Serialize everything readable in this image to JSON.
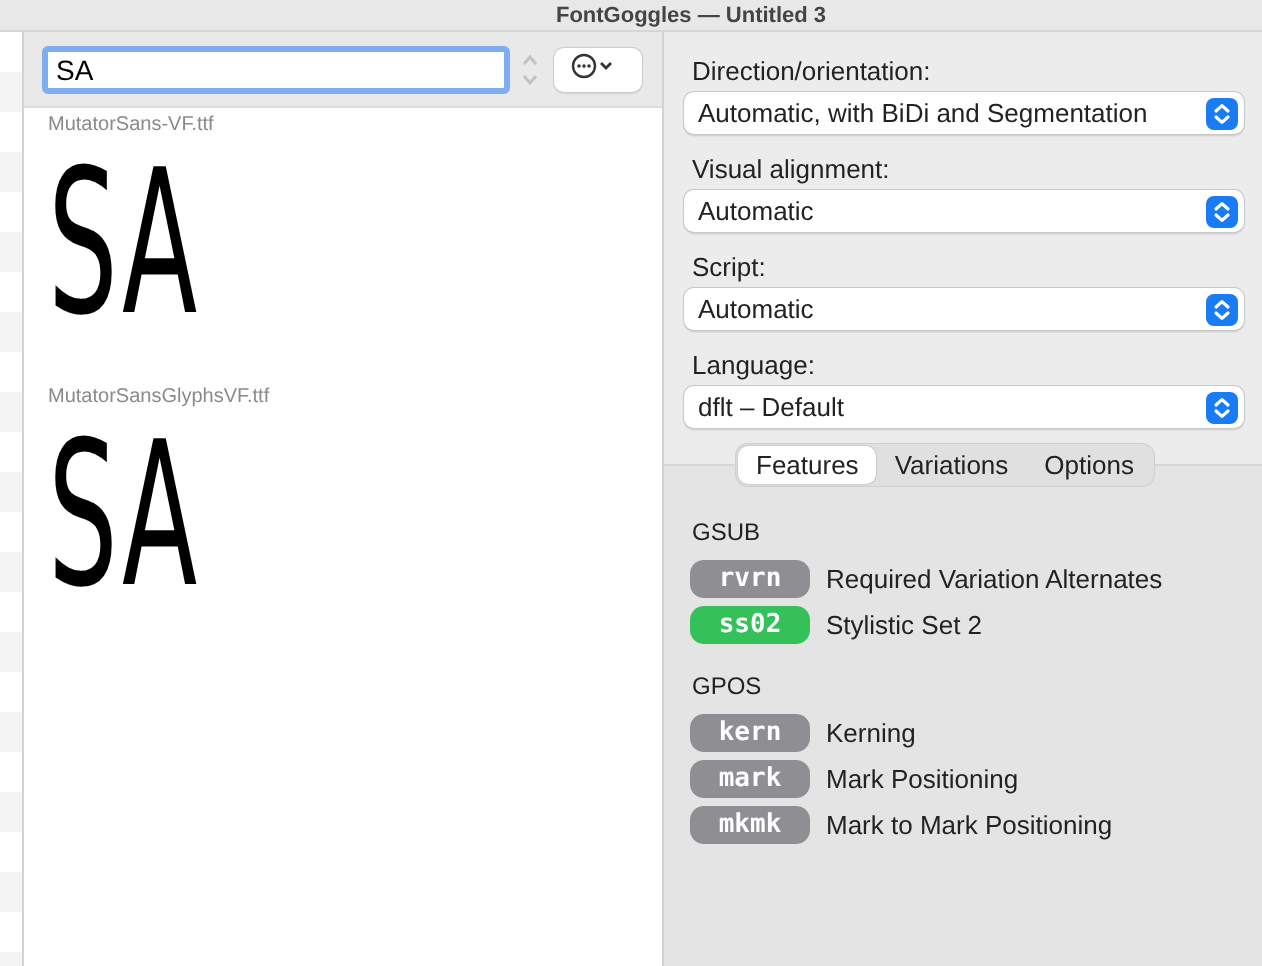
{
  "window": {
    "title": "FontGoggles — Untitled 3"
  },
  "text_field": {
    "value": "SA"
  },
  "fonts": [
    {
      "file": "MutatorSans-VF.ttf",
      "sample": "SA"
    },
    {
      "file": "MutatorSansGlyphsVF.ttf",
      "sample": "SA"
    }
  ],
  "settings": [
    {
      "label": "Direction/orientation:",
      "value": "Automatic, with BiDi and Segmentation"
    },
    {
      "label": "Visual alignment:",
      "value": "Automatic"
    },
    {
      "label": "Script:",
      "value": "Automatic"
    },
    {
      "label": "Language:",
      "value": "dflt – Default"
    }
  ],
  "tabs": [
    {
      "label": "Features",
      "selected": true
    },
    {
      "label": "Variations",
      "selected": false
    },
    {
      "label": "Options",
      "selected": false
    }
  ],
  "feature_groups": [
    {
      "title": "GSUB",
      "features": [
        {
          "tag": "rvrn",
          "name": "Required Variation Alternates",
          "enabled": false
        },
        {
          "tag": "ss02",
          "name": "Stylistic Set 2",
          "enabled": true
        }
      ]
    },
    {
      "title": "GPOS",
      "features": [
        {
          "tag": "kern",
          "name": "Kerning",
          "enabled": false
        },
        {
          "tag": "mark",
          "name": "Mark Positioning",
          "enabled": false
        },
        {
          "tag": "mkmk",
          "name": "Mark to Mark Positioning",
          "enabled": false
        }
      ]
    }
  ]
}
